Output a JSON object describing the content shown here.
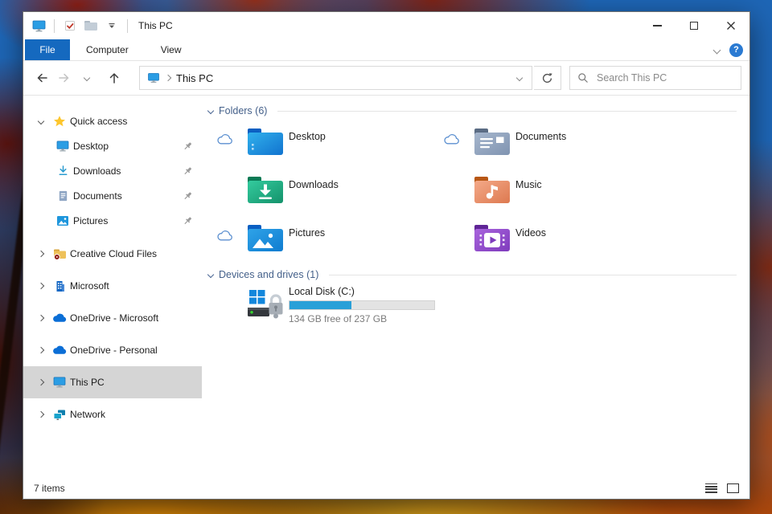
{
  "window": {
    "title": "This PC"
  },
  "ribbon": {
    "tabs": [
      {
        "label": "File",
        "active": true
      },
      {
        "label": "Computer",
        "active": false
      },
      {
        "label": "View",
        "active": false
      }
    ],
    "help_label": "?"
  },
  "navbar": {
    "address": {
      "location": "This PC"
    },
    "search": {
      "placeholder": "Search This PC"
    }
  },
  "sidebar": {
    "items": [
      {
        "label": "Quick access",
        "icon": "star-icon",
        "expanded": true
      },
      {
        "label": "Desktop",
        "icon": "monitor-icon",
        "pinned": true
      },
      {
        "label": "Downloads",
        "icon": "download-arrow-icon",
        "pinned": true
      },
      {
        "label": "Documents",
        "icon": "document-icon",
        "pinned": true
      },
      {
        "label": "Pictures",
        "icon": "picture-icon",
        "pinned": true
      },
      {
        "label": "Creative Cloud Files",
        "icon": "creative-cloud-folder-icon"
      },
      {
        "label": "Microsoft",
        "icon": "building-icon"
      },
      {
        "label": "OneDrive - Microsoft",
        "icon": "onedrive-cloud-icon"
      },
      {
        "label": "OneDrive - Personal",
        "icon": "onedrive-cloud-icon"
      },
      {
        "label": "This PC",
        "icon": "monitor-icon",
        "selected": true
      },
      {
        "label": "Network",
        "icon": "network-icon"
      }
    ]
  },
  "main": {
    "groups": {
      "folders": {
        "label": "Folders (6)"
      },
      "drives": {
        "label": "Devices and drives (1)"
      }
    },
    "folders": [
      {
        "label": "Desktop",
        "icon": "folder-desktop-icon",
        "cloud_status": true
      },
      {
        "label": "Documents",
        "icon": "folder-documents-icon",
        "cloud_status": true
      },
      {
        "label": "Downloads",
        "icon": "folder-downloads-icon",
        "cloud_status": false
      },
      {
        "label": "Music",
        "icon": "folder-music-icon",
        "cloud_status": false
      },
      {
        "label": "Pictures",
        "icon": "folder-pictures-icon",
        "cloud_status": true
      },
      {
        "label": "Videos",
        "icon": "folder-videos-icon",
        "cloud_status": false
      }
    ],
    "drive": {
      "label": "Local Disk (C:)",
      "capacity_text": "134 GB free of 237 GB",
      "used_percent": 43
    }
  },
  "statusbar": {
    "items_count": "7 items"
  },
  "colors": {
    "accent_blue": "#1569bf",
    "drive_bar_fill": "#29a0d8",
    "selection_gray": "#d5d5d5",
    "group_header_blue": "#44608a"
  }
}
